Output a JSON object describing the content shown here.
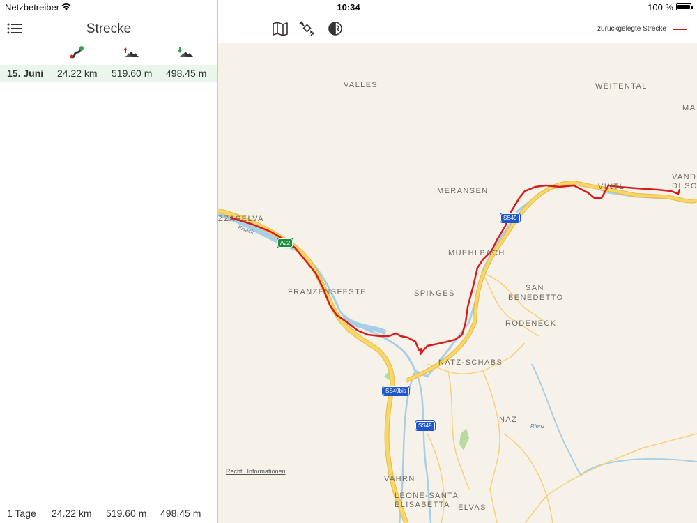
{
  "status_bar": {
    "carrier": "Netzbetreiber",
    "time": "10:34",
    "battery": "100 %"
  },
  "sidebar": {
    "title": "Strecke",
    "column_icons": [
      "route-distance-icon",
      "ascent-icon",
      "descent-icon"
    ],
    "rows": [
      {
        "date": "15. Juni",
        "distance": "24.22 km",
        "ascent": "519.60 m",
        "descent": "498.45 m"
      }
    ],
    "footer": {
      "days": "1 Tage",
      "distance": "24.22 km",
      "ascent": "519.60 m",
      "descent": "498.45 m"
    }
  },
  "toolbar": {
    "tools": [
      "map-icon",
      "satellite-icon",
      "hybrid-icon"
    ],
    "legend_label": "zurückgelegte Strecke",
    "track_color": "#d91b1b"
  },
  "map": {
    "places": [
      "VALLES",
      "WEITENTAL",
      "MA",
      "MERANSEN",
      "VAND",
      "DI SO",
      "VINTL",
      "ZZASELVA",
      "MUEHLBACH",
      "FRANZENSFESTE",
      "SPINGES",
      "SAN",
      "BENEDETTO",
      "RODENECK",
      "NATZ-SCHABS",
      "NAZ",
      "VAHRN",
      "LEONE-SANTA",
      "ELISABETTA",
      "ELVAS"
    ],
    "rivers": [
      "Eisack",
      "Rienz"
    ],
    "road_badges": [
      "A22",
      "SS49",
      "SS49bis",
      "SS49"
    ],
    "legal_link": "Rechtl. Informationen"
  }
}
